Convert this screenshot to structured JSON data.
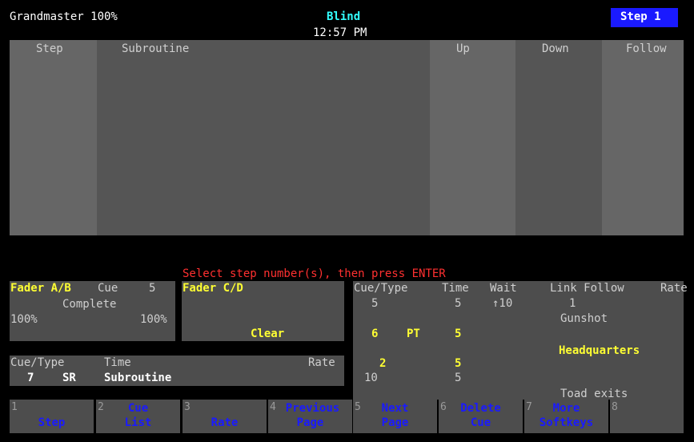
{
  "header": {
    "grandmaster": "Grandmaster 100%",
    "mode": "Blind",
    "clock": "12:57 PM",
    "step_badge": "Step 1"
  },
  "table": {
    "columns": [
      "Step",
      "Subroutine",
      "Up",
      "Down",
      "Follow"
    ]
  },
  "prompt": "Select step number(s), then press ENTER",
  "fader_ab": {
    "title": "Fader A/B",
    "cue_label": "Cue",
    "cue_value": "5",
    "status": "Complete",
    "left_level": "100%",
    "right_level": "100%"
  },
  "fader_cd": {
    "title": "Fader C/D",
    "status": "Clear"
  },
  "cue_info": {
    "headers": {
      "cue_type": "Cue/Type",
      "time": "Time",
      "rate": "Rate"
    },
    "cue": "7",
    "type": "SR",
    "time": "Subroutine"
  },
  "cue_list": {
    "headers": {
      "cue_type": "Cue/Type",
      "time": "Time",
      "wait": "Wait",
      "link_follow": "Link Follow",
      "rate": "Rate"
    },
    "rows": [
      {
        "cue": "5",
        "type": "",
        "time": "5",
        "wait": "↑10",
        "link": "1",
        "label": "Gunshot"
      },
      {
        "cue": "6",
        "type": "PT",
        "time": "5",
        "wait": "",
        "link": "",
        "label": ""
      },
      {
        "cue": "2",
        "type": "",
        "time": "5",
        "wait": "",
        "link": "",
        "label": "Headquarters"
      },
      {
        "cue": "10",
        "type": "",
        "time": "5",
        "wait": "",
        "link": "",
        "label": "Toad exits"
      }
    ]
  },
  "softkeys": [
    {
      "num": "1",
      "line1": "",
      "line2": "Step"
    },
    {
      "num": "2",
      "line1": "Cue",
      "line2": "List"
    },
    {
      "num": "3",
      "line1": "",
      "line2": "Rate"
    },
    {
      "num": "4",
      "line1": "Previous",
      "line2": "Page"
    },
    {
      "num": "5",
      "line1": "Next",
      "line2": "Page"
    },
    {
      "num": "6",
      "line1": "Delete",
      "line2": "Cue"
    },
    {
      "num": "7",
      "line1": "More",
      "line2": "Softkeys"
    },
    {
      "num": "8",
      "line1": "",
      "line2": ""
    }
  ],
  "colors": {
    "background": "#000000",
    "panel": "#4d4d4d",
    "highlight_text": "#ffff33",
    "mode_text": "#33ffff",
    "prompt_text": "#ff3030",
    "softkey_text": "#1a1aff",
    "badge_bg": "#1a1aff"
  }
}
